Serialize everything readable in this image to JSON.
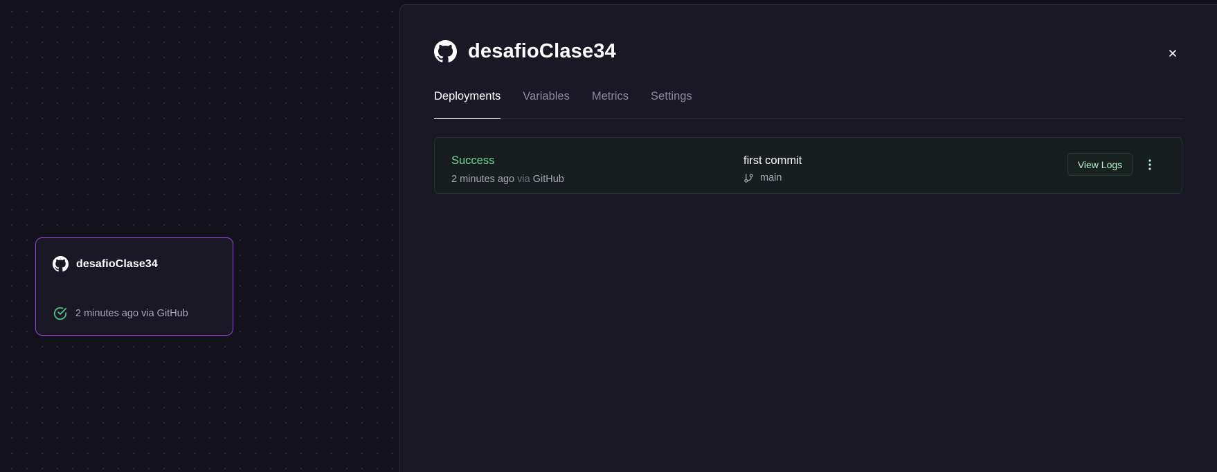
{
  "service_card": {
    "title": "desafioClase34",
    "status_text": "2 minutes ago via GitHub",
    "icon_github": "github-icon",
    "icon_status": "check-circle-icon"
  },
  "panel": {
    "title": "desafioClase34",
    "icon": "github-icon",
    "close_icon": "close-icon",
    "tabs": [
      {
        "label": "Deployments",
        "active": true
      },
      {
        "label": "Variables",
        "active": false
      },
      {
        "label": "Metrics",
        "active": false
      },
      {
        "label": "Settings",
        "active": false
      }
    ]
  },
  "deployment": {
    "status": "Success",
    "time": "2 minutes ago",
    "via": "via",
    "source": "GitHub",
    "commit_message": "first commit",
    "branch": "main",
    "branch_icon": "git-branch-icon",
    "view_logs_label": "View Logs",
    "more_icon": "more-vertical-icon"
  },
  "colors": {
    "background": "#13111c",
    "panel": "#1b1826",
    "accent_border": "#8a3fd1",
    "success": "#6ed59a"
  }
}
